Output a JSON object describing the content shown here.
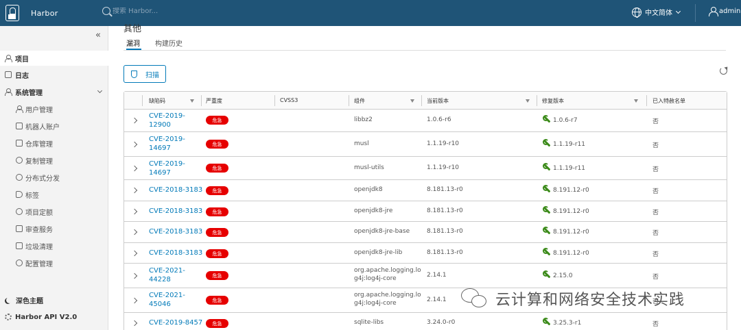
{
  "header": {
    "brand": "Harbor",
    "search_placeholder": "搜索 Harbor...",
    "language": "中文简体",
    "user": "admin"
  },
  "sidebar": {
    "collapse_glyph": "«",
    "items": [
      {
        "label": "项目",
        "icon": "projects-icon"
      },
      {
        "label": "日志",
        "icon": "logs-icon"
      },
      {
        "label": "系统管理",
        "icon": "admin-icon"
      }
    ],
    "sub_items": [
      {
        "label": "用户管理",
        "icon": "users-icon"
      },
      {
        "label": "机器人账户",
        "icon": "robot-icon"
      },
      {
        "label": "仓库管理",
        "icon": "registry-icon"
      },
      {
        "label": "复制管理",
        "icon": "replication-icon"
      },
      {
        "label": "分布式分发",
        "icon": "distribution-icon"
      },
      {
        "label": "标签",
        "icon": "tag-icon"
      },
      {
        "label": "项目定额",
        "icon": "quota-icon"
      },
      {
        "label": "审查服务",
        "icon": "interrogation-icon"
      },
      {
        "label": "垃圾清理",
        "icon": "trash-icon"
      },
      {
        "label": "配置管理",
        "icon": "config-icon"
      }
    ],
    "dark_theme": "深色主题",
    "api_link": "Harbor API V2.0"
  },
  "main": {
    "section_title_partial": "其他",
    "tabs": [
      "漏洞",
      "构建历史"
    ],
    "scan_button": "扫描",
    "columns": [
      "缺陷码",
      "严重度",
      "CVSS3",
      "组件",
      "当前版本",
      "修复版本",
      "已入特赦名单"
    ],
    "severity_label": "危急",
    "rows": [
      {
        "cve": "CVE-2019-12900",
        "component": "libbz2",
        "current": "1.0.6-r6",
        "fixed": "1.0.6-r7",
        "allowlisted": "否"
      },
      {
        "cve": "CVE-2019-14697",
        "component": "musl",
        "current": "1.1.19-r10",
        "fixed": "1.1.19-r11",
        "allowlisted": "否"
      },
      {
        "cve": "CVE-2019-14697",
        "component": "musl-utils",
        "current": "1.1.19-r10",
        "fixed": "1.1.19-r11",
        "allowlisted": "否"
      },
      {
        "cve": "CVE-2018-3183",
        "component": "openjdk8",
        "current": "8.181.13-r0",
        "fixed": "8.191.12-r0",
        "allowlisted": "否"
      },
      {
        "cve": "CVE-2018-3183",
        "component": "openjdk8-jre",
        "current": "8.181.13-r0",
        "fixed": "8.191.12-r0",
        "allowlisted": "否"
      },
      {
        "cve": "CVE-2018-3183",
        "component": "openjdk8-jre-base",
        "current": "8.181.13-r0",
        "fixed": "8.191.12-r0",
        "allowlisted": "否"
      },
      {
        "cve": "CVE-2018-3183",
        "component": "openjdk8-jre-lib",
        "current": "8.181.13-r0",
        "fixed": "8.191.12-r0",
        "allowlisted": "否"
      },
      {
        "cve": "CVE-2021-44228",
        "component": "org.apache.logging.log4j:log4j-core",
        "current": "2.14.1",
        "fixed": "2.15.0",
        "allowlisted": "否"
      },
      {
        "cve": "CVE-2021-45046",
        "component": "org.apache.logging.log4j:log4j-core",
        "current": "2.14.1",
        "fixed": "",
        "allowlisted": "否"
      },
      {
        "cve": "CVE-2019-8457",
        "component": "sqlite-libs",
        "current": "3.24.0-r0",
        "fixed": "3.25.3-r1",
        "allowlisted": "否"
      }
    ]
  },
  "watermark": "云计算和网络安全技术实践",
  "colors": {
    "header_bg": "#1f5477",
    "accent": "#0079b8",
    "critical": "#e60000",
    "fix_green": "#3b8a19"
  }
}
